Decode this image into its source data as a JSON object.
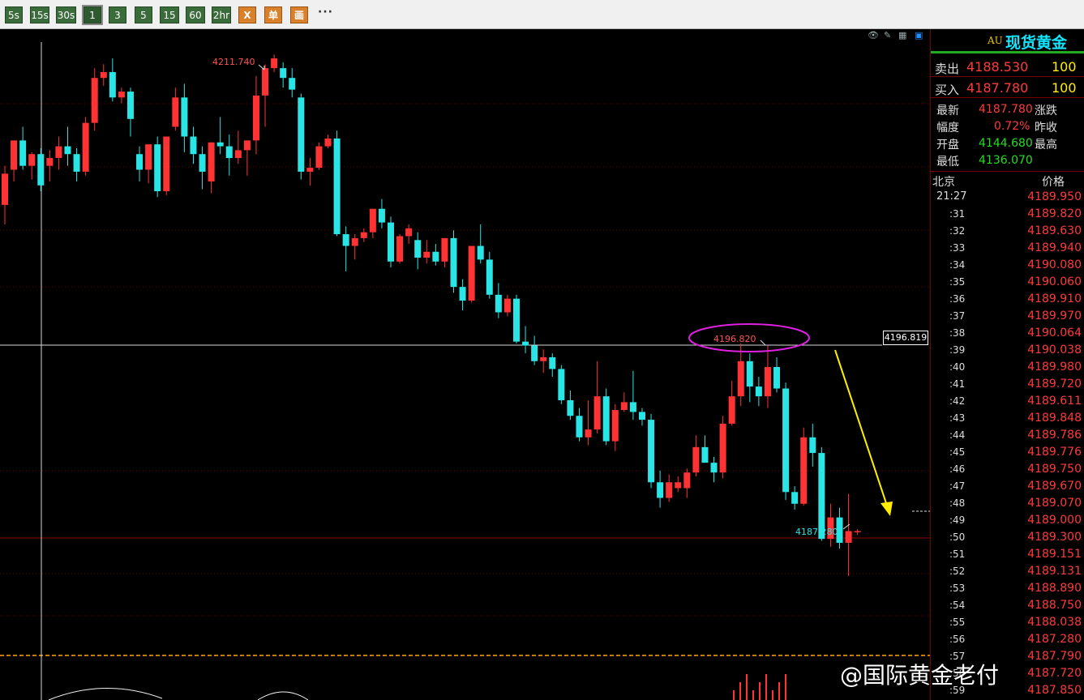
{
  "toolbar": {
    "buttons": [
      "5s",
      "15s",
      "30s",
      "1",
      "3",
      "5",
      "15",
      "60",
      "2hr"
    ],
    "selected": "1",
    "icon_buttons": [
      "X",
      "单",
      "画"
    ],
    "more": "···"
  },
  "instrument": {
    "code": "AU",
    "name": "现货黄金"
  },
  "quote": {
    "sell_label": "卖出",
    "sell_price": "4188.530",
    "sell_vol": "100",
    "buy_label": "买入",
    "buy_price": "4187.780",
    "buy_vol": "100",
    "latest_label": "最新",
    "latest": "4187.780",
    "change_label": "涨跌",
    "range_label": "幅度",
    "range": "0.72%",
    "prevclose_label": "昨收",
    "open_label": "开盘",
    "open": "4144.680",
    "high_label": "最高",
    "low_label": "最低",
    "low": "4136.070"
  },
  "timesales": {
    "col_time": "北京",
    "col_price": "价格",
    "rows": [
      {
        "t": "21:27",
        "p": "4189.950"
      },
      {
        "t": ":31",
        "p": "4189.820"
      },
      {
        "t": ":32",
        "p": "4189.630"
      },
      {
        "t": ":33",
        "p": "4189.940"
      },
      {
        "t": ":34",
        "p": "4190.080"
      },
      {
        "t": ":35",
        "p": "4190.060"
      },
      {
        "t": ":36",
        "p": "4189.910"
      },
      {
        "t": ":37",
        "p": "4189.970"
      },
      {
        "t": ":38",
        "p": "4190.064"
      },
      {
        "t": ":39",
        "p": "4190.038"
      },
      {
        "t": ":40",
        "p": "4189.980"
      },
      {
        "t": ":41",
        "p": "4189.720"
      },
      {
        "t": ":42",
        "p": "4189.611"
      },
      {
        "t": ":43",
        "p": "4189.848"
      },
      {
        "t": ":44",
        "p": "4189.786"
      },
      {
        "t": ":45",
        "p": "4189.776"
      },
      {
        "t": ":46",
        "p": "4189.750"
      },
      {
        "t": ":47",
        "p": "4189.670"
      },
      {
        "t": ":48",
        "p": "4189.070"
      },
      {
        "t": ":49",
        "p": "4189.000"
      },
      {
        "t": ":50",
        "p": "4189.300"
      },
      {
        "t": ":51",
        "p": "4189.151"
      },
      {
        "t": ":52",
        "p": "4189.131"
      },
      {
        "t": ":53",
        "p": "4188.890"
      },
      {
        "t": ":54",
        "p": "4188.750"
      },
      {
        "t": ":55",
        "p": "4188.038"
      },
      {
        "t": ":56",
        "p": "4187.280"
      },
      {
        "t": ":57",
        "p": "4187.790"
      },
      {
        "t": ":58",
        "p": "4187.720"
      },
      {
        "t": ":59",
        "p": "4187.850"
      }
    ]
  },
  "chart_labels": {
    "high_marker": "4211.740",
    "circled_marker": "4196.820",
    "low_marker": "4187.280",
    "crosshair_price": "4196.819"
  },
  "watermark": "@国际黄金老付",
  "colors": {
    "up": "#ff3333",
    "down": "#29e5e5",
    "ellipse": "#e020e0",
    "arrow": "#ffee00"
  },
  "chart_data": {
    "type": "candlestick",
    "ylim": [
      4184.0,
      4215.0
    ],
    "candles": [
      [
        4204,
        4206,
        4203,
        4205.6
      ],
      [
        4205.8,
        4207,
        4205.2,
        4207.3
      ],
      [
        4207.3,
        4208,
        4205.8,
        4206
      ],
      [
        4206,
        4206.7,
        4205.3,
        4206.6
      ],
      [
        4206.6,
        4206.9,
        4204.7,
        4205.0
      ],
      [
        4206.0,
        4206.8,
        4205.2,
        4206.4
      ],
      [
        4206.4,
        4207.5,
        4205.8,
        4207
      ],
      [
        4207,
        4208,
        4206,
        4206.6
      ],
      [
        4206.6,
        4206.9,
        4205.2,
        4205.7
      ],
      [
        4205.7,
        4208.5,
        4205.5,
        4208.2
      ],
      [
        4208.2,
        4211,
        4207.8,
        4210.5
      ],
      [
        4210.5,
        4211.2,
        4210.1,
        4210.8
      ],
      [
        4210.8,
        4211.5,
        4209.3,
        4209.5
      ],
      [
        4209.5,
        4210,
        4209.2,
        4209.8
      ],
      [
        4209.8,
        4210,
        4207.5,
        4208.4
      ],
      [
        4206.6,
        4207,
        4205.2,
        4205.8
      ],
      [
        4205.8,
        4207,
        4205.1,
        4207.1
      ],
      [
        4207.1,
        4207.5,
        4204.4,
        4204.7
      ],
      [
        4204.7,
        4207.5,
        4204.5,
        4207.5
      ],
      [
        4208,
        4210,
        4207.8,
        4209.5
      ],
      [
        4209.5,
        4210.2,
        4206.7,
        4207.5
      ],
      [
        4207.5,
        4208,
        4206.1,
        4206.6
      ],
      [
        4206.6,
        4207,
        4204.8,
        4205.7
      ],
      [
        4205.2,
        4207.2,
        4204.6,
        4207.2
      ],
      [
        4207.2,
        4208.5,
        4206.6,
        4207
      ],
      [
        4207,
        4207.6,
        4205.5,
        4206.4
      ],
      [
        4206.4,
        4207.8,
        4206.1,
        4206.8
      ],
      [
        4206.8,
        4207.3,
        4205.5,
        4207.3
      ],
      [
        4207.3,
        4210.6,
        4206.6,
        4209.6
      ],
      [
        4209.6,
        4211.2,
        4208,
        4211
      ],
      [
        4211.0,
        4211.7,
        4210.8,
        4211.5
      ],
      [
        4211.0,
        4211.3,
        4210,
        4210.5
      ],
      [
        4210.5,
        4211,
        4209.5,
        4209.9
      ],
      [
        4209.5,
        4209.7,
        4205.3,
        4205.7
      ],
      [
        4205.7,
        4206.4,
        4205,
        4205.9
      ],
      [
        4205.9,
        4207.2,
        4205.8,
        4207
      ],
      [
        4207,
        4207.6,
        4206.9,
        4207.4
      ],
      [
        4207.4,
        4207.8,
        4202.4,
        4202.5
      ],
      [
        4202.5,
        4202.9,
        4200.6,
        4201.9
      ],
      [
        4201.9,
        4202.5,
        4201.2,
        4202.3
      ],
      [
        4202.3,
        4202.8,
        4202.1,
        4202.6
      ],
      [
        4202.6,
        4203.8,
        4202.3,
        4203.8
      ],
      [
        4203.8,
        4204.3,
        4202.8,
        4203.1
      ],
      [
        4203.1,
        4203.4,
        4200.8,
        4201.1
      ],
      [
        4201.1,
        4202.5,
        4201,
        4202.4
      ],
      [
        4202.4,
        4203,
        4202,
        4202.8
      ],
      [
        4202.2,
        4202.6,
        4200.7,
        4201.3
      ],
      [
        4201.3,
        4202.2,
        4201,
        4201.6
      ],
      [
        4201.6,
        4202,
        4200.9,
        4201.1
      ],
      [
        4201.1,
        4202.3,
        4200.8,
        4202.3
      ],
      [
        4202.3,
        4202.7,
        4199.5,
        4199.8
      ],
      [
        4199.8,
        4200.2,
        4198.6,
        4199.1
      ],
      [
        4199.1,
        4201.9,
        4199.0,
        4201.9
      ],
      [
        4201.9,
        4203.0,
        4201,
        4201.2
      ],
      [
        4201.2,
        4201.6,
        4199.2,
        4199.4
      ],
      [
        4199.4,
        4200,
        4198.2,
        4198.5
      ],
      [
        4198.5,
        4199.4,
        4198.3,
        4199.2
      ],
      [
        4199.2,
        4199.4,
        4196.9,
        4197.0
      ],
      [
        4197.0,
        4197.8,
        4196.4,
        4196.8
      ],
      [
        4196.8,
        4197.3,
        4195.8,
        4196.0
      ],
      [
        4196.0,
        4196.6,
        4195.4,
        4196.2
      ],
      [
        4196.2,
        4196.4,
        4195.2,
        4195.6
      ],
      [
        4195.6,
        4195.8,
        4193.8,
        4194.0
      ],
      [
        4194.0,
        4194.5,
        4193,
        4193.2
      ],
      [
        4193.2,
        4193.6,
        4191.9,
        4192.1
      ],
      [
        4192.1,
        4194.0,
        4191.7,
        4192.5
      ],
      [
        4192.5,
        4196.0,
        4192.3,
        4194.2
      ],
      [
        4194.2,
        4194.6,
        4191.7,
        4191.9
      ],
      [
        4191.9,
        4193.8,
        4191.4,
        4193.5
      ],
      [
        4193.5,
        4194.4,
        4193.4,
        4193.9
      ],
      [
        4193.9,
        4195.5,
        4193,
        4193.4
      ],
      [
        4193.4,
        4193.6,
        4192.7,
        4193.0
      ],
      [
        4193.0,
        4193.3,
        4189.5,
        4189.8
      ],
      [
        4189.8,
        4190.4,
        4188.5,
        4189.0
      ],
      [
        4189.0,
        4190.2,
        4188.8,
        4189.8
      ],
      [
        4189.5,
        4190.1,
        4189.3,
        4189.8
      ],
      [
        4189.5,
        4190.5,
        4189,
        4190.3
      ],
      [
        4190.3,
        4192.2,
        4190.1,
        4191.6
      ],
      [
        4191.6,
        4192.2,
        4190.8,
        4190.8
      ],
      [
        4190.8,
        4191.1,
        4189.8,
        4190.3
      ],
      [
        4190.3,
        4193.2,
        4190.0,
        4192.8
      ],
      [
        4192.8,
        4195.0,
        4192.7,
        4194.2
      ],
      [
        4194.2,
        4196.9,
        4193.7,
        4196.0
      ],
      [
        4196.0,
        4196.4,
        4193.9,
        4194.7
      ],
      [
        4194.7,
        4195.2,
        4193.7,
        4194.2
      ],
      [
        4194.2,
        4196.8,
        4193.6,
        4195.7
      ],
      [
        4195.7,
        4196.2,
        4194.4,
        4194.6
      ],
      [
        4194.6,
        4194.9,
        4188.9,
        4189.3
      ],
      [
        4189.3,
        4189.6,
        4188.4,
        4188.7
      ],
      [
        4188.7,
        4192.6,
        4188.6,
        4192.1
      ],
      [
        4192.1,
        4192.8,
        4190.6,
        4191.3
      ],
      [
        4191.3,
        4191.6,
        4186.8,
        4186.9
      ],
      [
        4186.9,
        4188.7,
        4186.5,
        4188.0
      ],
      [
        4188.0,
        4188.5,
        4186.4,
        4186.7
      ],
      [
        4186.7,
        4189.2,
        4185.0,
        4187.3
      ],
      [
        4187.3,
        4187.4,
        4187.1,
        4187.3
      ]
    ]
  }
}
